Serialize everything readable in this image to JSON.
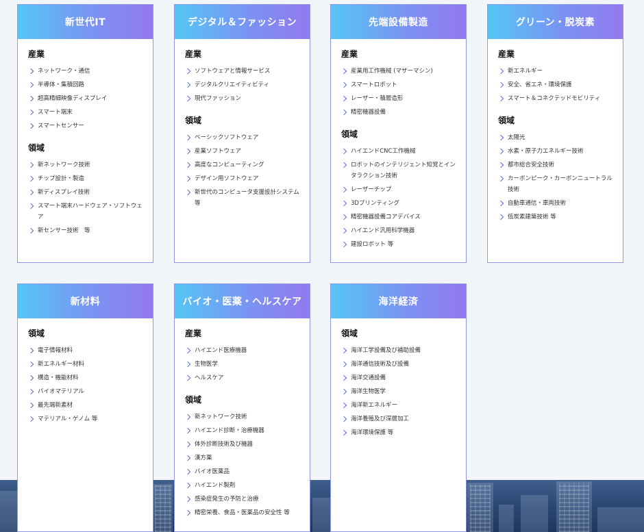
{
  "cards": [
    {
      "title": "新世代IT",
      "sections": [
        {
          "heading": "産業",
          "items": [
            "ネットワーク・通信",
            "半導体・集積回路",
            "超高精細映像ディスプレイ",
            "スマート端末",
            "スマートセンサー"
          ]
        },
        {
          "heading": "領域",
          "items": [
            "新ネットワーク技術",
            "チップ設計・製造",
            "新ディスプレイ技術",
            "スマート端末ハードウェア・ソフトウェア",
            "新センサー技術　等"
          ]
        }
      ]
    },
    {
      "title": "デジタル＆ファッション",
      "sections": [
        {
          "heading": "産業",
          "items": [
            "ソフトウェアと情報サービス",
            "デジタルクリエイティビティ",
            "現代ファッション"
          ]
        },
        {
          "heading": "領域",
          "items": [
            "ベーシックソフトウェア",
            "産業ソフトウェア",
            "高度なコンピューティング",
            "デザイン用ソフトウェア",
            "新世代のコンピュータ支援設計システム　等"
          ]
        }
      ]
    },
    {
      "title": "先端設備製造",
      "sections": [
        {
          "heading": "産業",
          "items": [
            "産業用工作機械 (マザーマシン)",
            "スマートロボット",
            "レーザー・積層造形",
            "精密機器設備"
          ]
        },
        {
          "heading": "領域",
          "items": [
            "ハイエンドCNC工作機械",
            "ロボットのインテリジェント知覚とインタラクション技術",
            "レーザーチップ",
            "3Dプリンティング",
            "精密機器設備コアデバイス",
            "ハイエンド汎用科学機器",
            "建設ロボット 等"
          ]
        }
      ]
    },
    {
      "title": "グリーン・脱炭素",
      "sections": [
        {
          "heading": "産業",
          "items": [
            "新エネルギー",
            "安全、省エネ・環境保護",
            "スマート＆コネクテッドモビリティ"
          ]
        },
        {
          "heading": "領域",
          "items": [
            "太陽光",
            "水素・原子力エネルギー技術",
            "都市総合安全技術",
            "カーボンピーク・カーボンニュートラル技術",
            "自動車通信・車両技術",
            "低炭素建築技術 等"
          ]
        }
      ]
    },
    {
      "title": "新材料",
      "sections": [
        {
          "heading": "領域",
          "items": [
            "電子情報材料",
            "新エネルギー材料",
            "構造・機能材料",
            "バイオマテリアル",
            "最先端新素材",
            "マテリアル・ゲノム 等"
          ]
        }
      ]
    },
    {
      "title": "バイオ・医薬・ヘルスケア",
      "sections": [
        {
          "heading": "産業",
          "items": [
            "ハイエンド医療機器",
            "生物医学",
            "ヘルスケア"
          ]
        },
        {
          "heading": "領域",
          "items": [
            "新ネットワーク技術",
            "ハイエンド診断・治療機器",
            "体外診断技術及び機器",
            "漢方薬",
            "バイオ医薬品",
            "ハイエンド製剤",
            "感染症発生の予防と治療",
            "精密栄養、食品・医薬品の安全性 等"
          ]
        }
      ]
    },
    {
      "title": "海洋経済",
      "sections": [
        {
          "heading": "領域",
          "items": [
            "海洋工学設備及び補助設備",
            "海洋通信技術及び設備",
            "海洋交通設備",
            "海洋生物医学",
            "海洋新エネルギー",
            "海洋養殖及び深層加工",
            "海洋環境保護 等"
          ]
        }
      ]
    }
  ]
}
